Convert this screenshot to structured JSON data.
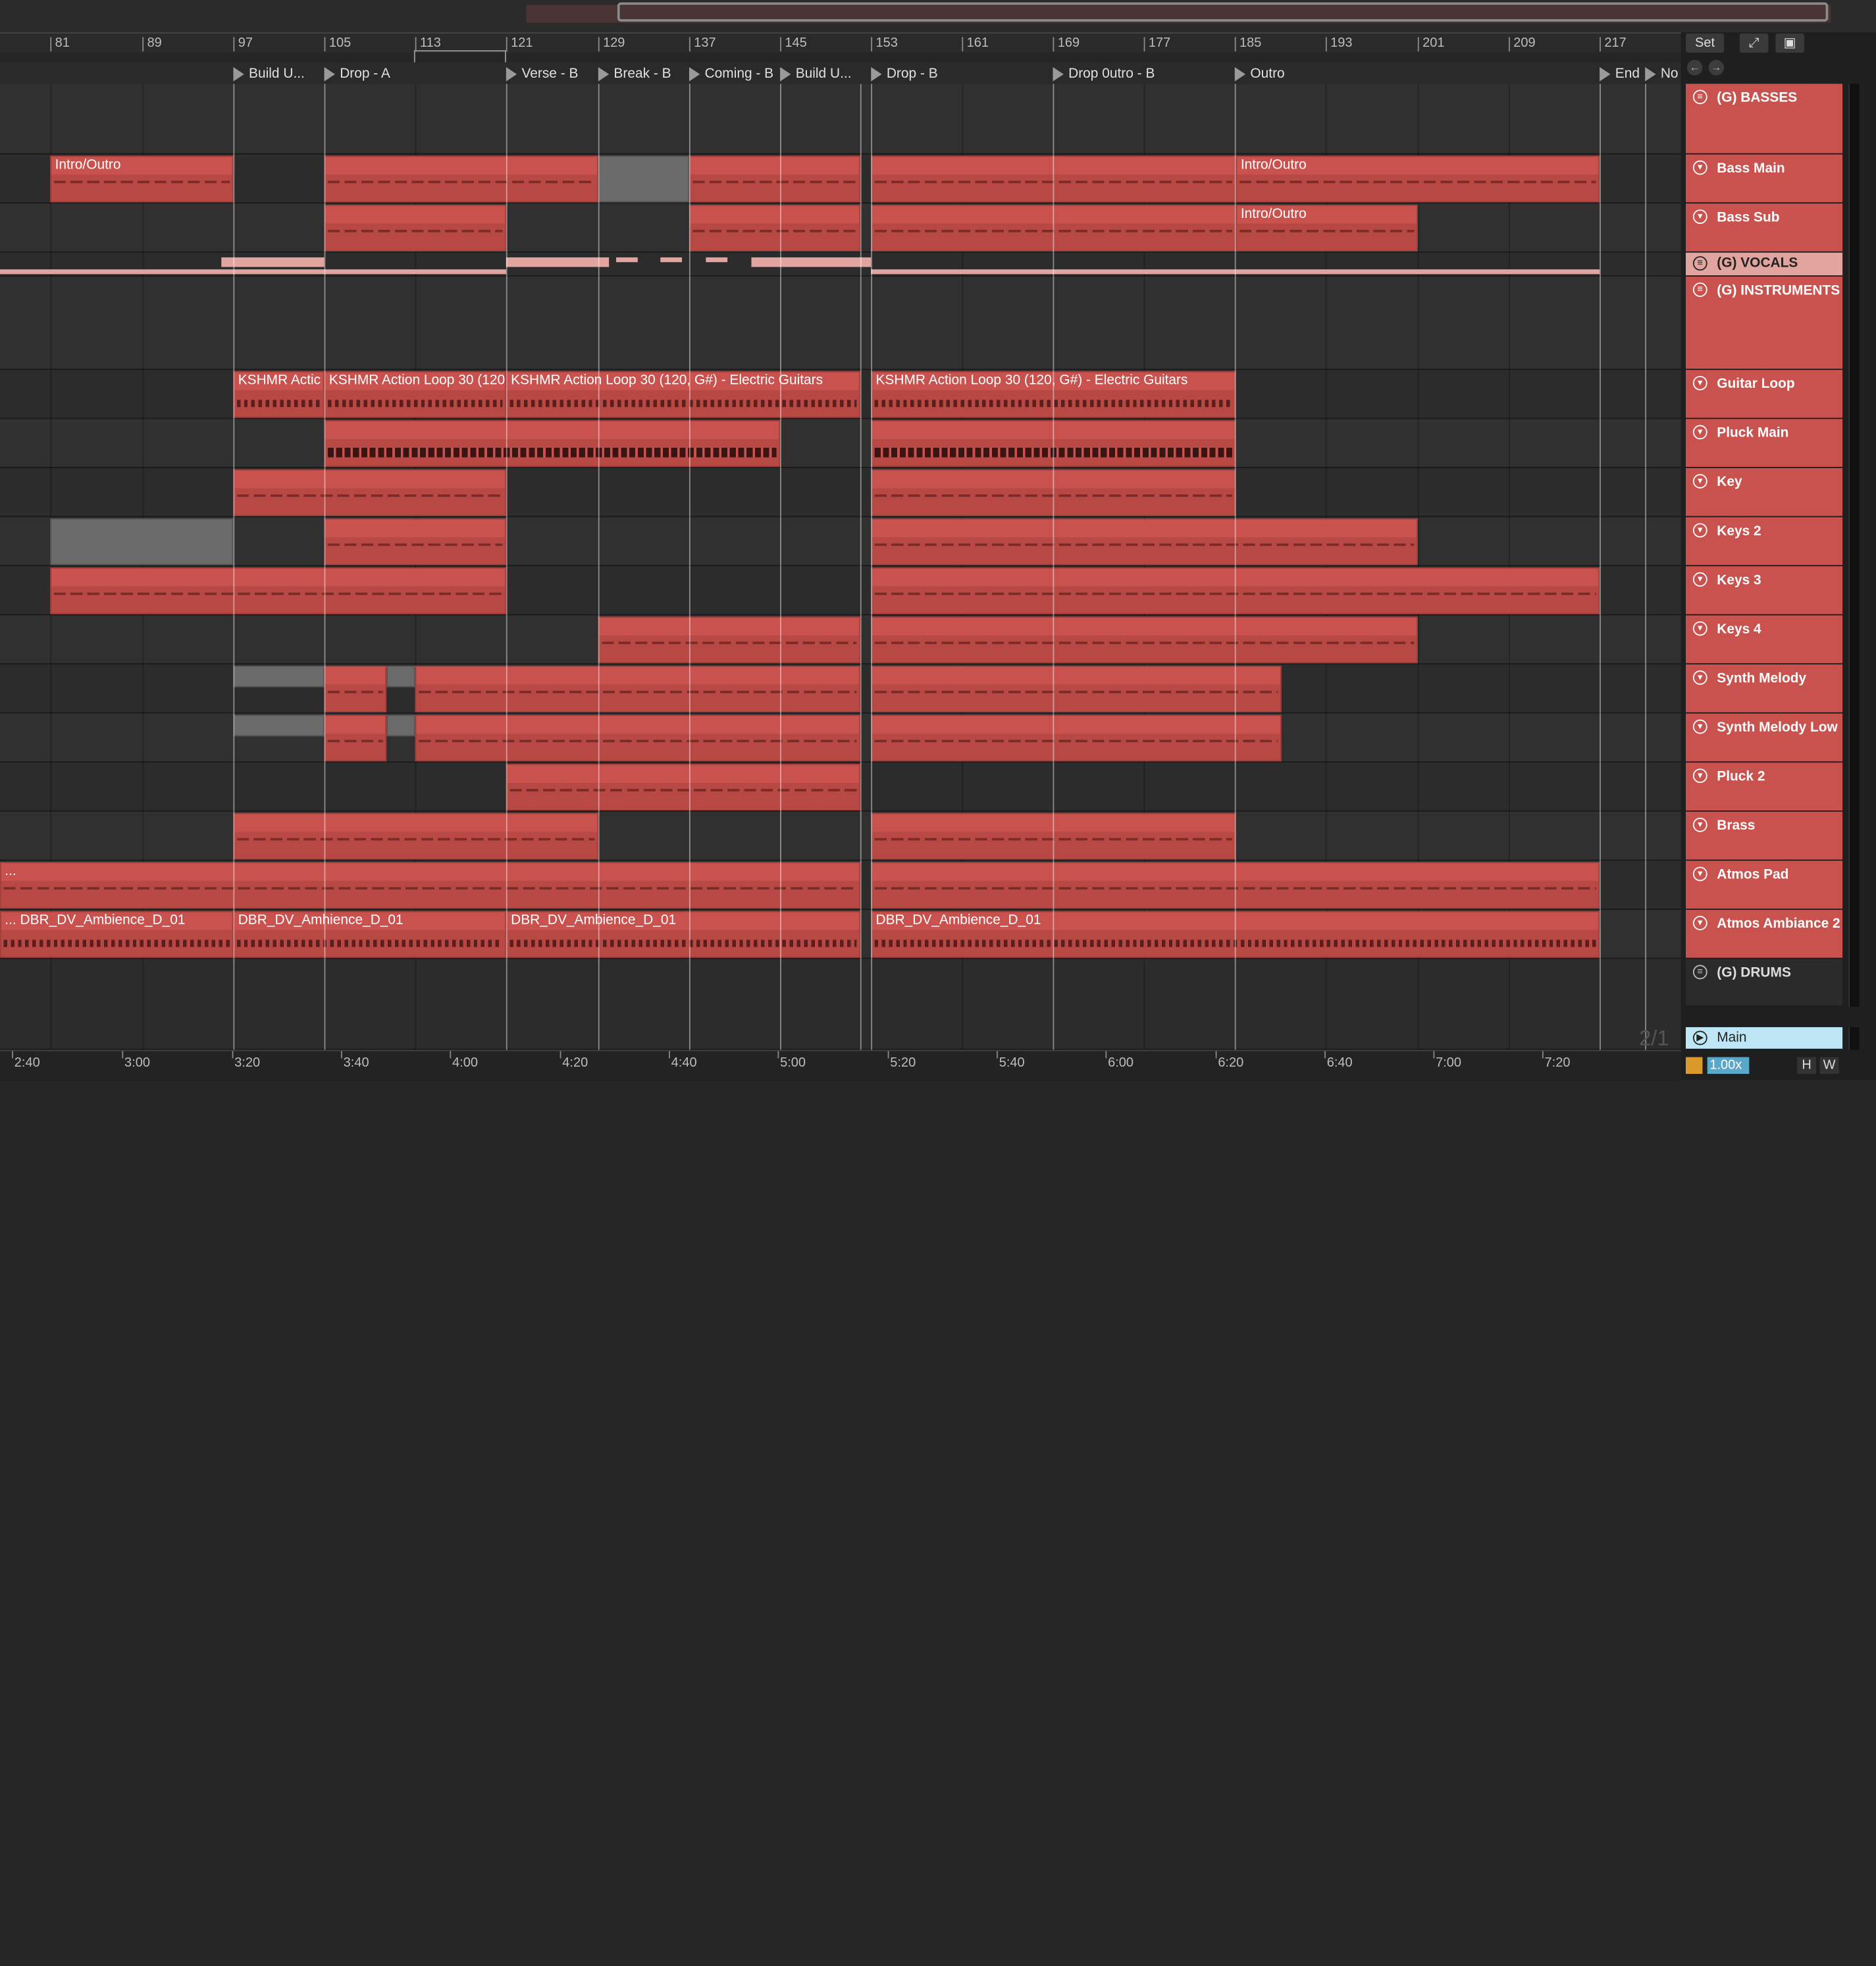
{
  "ruler": {
    "bars": [
      "81",
      "89",
      "97",
      "105",
      "113",
      "121",
      "129",
      "137",
      "145",
      "153",
      "161",
      "169",
      "177",
      "185",
      "193",
      "201",
      "209",
      "217"
    ]
  },
  "locators": [
    {
      "label": "Build U..."
    },
    {
      "label": "Drop - A"
    },
    {
      "label": "Verse - B"
    },
    {
      "label": "Break  - B"
    },
    {
      "label": "Coming - B"
    },
    {
      "label": "Build U..."
    },
    {
      "label": "Drop - B"
    },
    {
      "label": "Drop 0utro - B"
    },
    {
      "label": "Outro"
    },
    {
      "label": "End"
    },
    {
      "label": "No"
    }
  ],
  "clip_labels": {
    "intro_outro": "Intro/Outro",
    "kshmr_short": "KSHMR Actic",
    "kshmr_full": "KSHMR Action Loop 30 (120, G#) - Electric Guitars",
    "kshmr_mid": "KSHMR Action Loop 30 (120,",
    "kshmr_mid2": "KSHMR Action Loop 30 (120, G#) - Electric Guitars",
    "ambience": "DBR_DV_Ambience_D_01",
    "ambience_lead": "... DBR_DV_Ambience_D_01",
    "ambience_split": "DBR_DV_Amhience_D_01",
    "ellipsis": "..."
  },
  "tracks": [
    {
      "name": "(G) BASSES",
      "icon": "group-icon"
    },
    {
      "name": "Bass Main",
      "icon": "fold-icon"
    },
    {
      "name": "Bass Sub",
      "icon": "fold-icon"
    },
    {
      "name": "(G) VOCALS",
      "icon": "group-icon"
    },
    {
      "name": "(G) INSTRUMENTS",
      "icon": "group-icon"
    },
    {
      "name": "Guitar Loop",
      "icon": "fold-icon"
    },
    {
      "name": "Pluck Main",
      "icon": "fold-icon"
    },
    {
      "name": "Key",
      "icon": "fold-icon"
    },
    {
      "name": "Keys 2",
      "icon": "fold-icon"
    },
    {
      "name": "Keys 3",
      "icon": "fold-icon"
    },
    {
      "name": "Keys 4",
      "icon": "fold-icon"
    },
    {
      "name": "Synth Melody",
      "icon": "fold-icon"
    },
    {
      "name": "Synth Melody Low",
      "icon": "fold-icon"
    },
    {
      "name": "Pluck 2",
      "icon": "fold-icon"
    },
    {
      "name": "Brass",
      "icon": "fold-icon"
    },
    {
      "name": "Atmos Pad",
      "icon": "fold-icon"
    },
    {
      "name": "Atmos Ambiance 2",
      "icon": "fold-icon"
    },
    {
      "name": "(G) DRUMS",
      "icon": "group-icon"
    },
    {
      "name": "Main",
      "icon": "play-icon"
    }
  ],
  "timeline": [
    "2:40",
    "3:00",
    "3:20",
    "3:40",
    "4:00",
    "4:20",
    "4:40",
    "5:00",
    "5:20",
    "5:40",
    "6:00",
    "6:20",
    "6:40",
    "7:00",
    "7:20"
  ],
  "controls": {
    "set_label": "Set",
    "expand_icon": "expand-icon",
    "lock_icon": "lock-icon",
    "zoom": "1.00x",
    "h_label": "H",
    "w_label": "W",
    "page_count": "2/1"
  },
  "colors": {
    "clip_red": "#c9524e",
    "vocals_pink": "#e1a49f",
    "main_blue": "#bfe6f5",
    "background": "#2c2c2c"
  }
}
